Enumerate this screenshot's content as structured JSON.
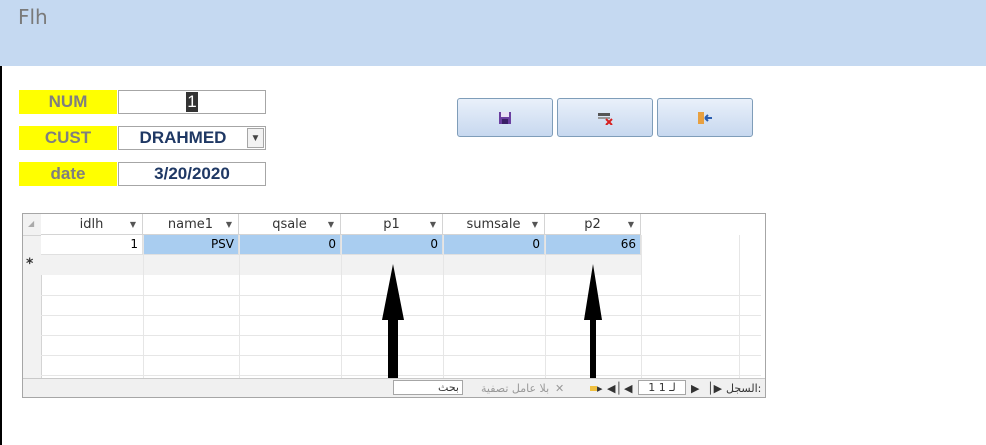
{
  "window": {
    "title": "Flh"
  },
  "form": {
    "num": {
      "label": "NUM",
      "value": "1"
    },
    "cust": {
      "label": "CUST",
      "value": "DRAHMED"
    },
    "date": {
      "label": "date",
      "value": "3/20/2020"
    }
  },
  "toolbar": {
    "save_icon": "save-icon",
    "delete_icon": "delete-record-icon",
    "exit_icon": "exit-icon"
  },
  "grid": {
    "columns": [
      "idlh",
      "name1",
      "qsale",
      "p1",
      "sumsale",
      "p2"
    ],
    "rows": [
      [
        "1",
        "PSV",
        "0",
        "0",
        "0",
        "66"
      ]
    ],
    "new_row_marker": "*",
    "selected_row_color": "#a9cdf0"
  },
  "navigation": {
    "record_label": "السجل:",
    "record_position": "1 لـ 1",
    "filter_label": "بلا عامل تصفية",
    "search_placeholder": "بحث"
  }
}
